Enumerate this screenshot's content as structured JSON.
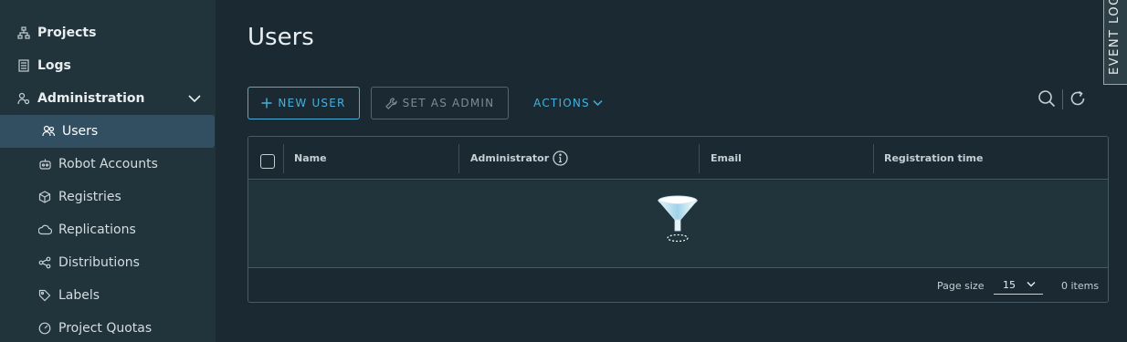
{
  "sidebar": {
    "items": [
      {
        "label": "Projects",
        "icon": "projects-icon"
      },
      {
        "label": "Logs",
        "icon": "logs-icon"
      },
      {
        "label": "Administration",
        "icon": "administration-icon",
        "expanded": true
      },
      {
        "label": "Users",
        "icon": "users-icon",
        "active": true
      },
      {
        "label": "Robot Accounts",
        "icon": "robot-icon"
      },
      {
        "label": "Registries",
        "icon": "registries-icon"
      },
      {
        "label": "Replications",
        "icon": "replications-icon"
      },
      {
        "label": "Distributions",
        "icon": "distributions-icon"
      },
      {
        "label": "Labels",
        "icon": "labels-icon"
      },
      {
        "label": "Project Quotas",
        "icon": "quotas-icon"
      }
    ]
  },
  "main": {
    "title": "Users",
    "toolbar": {
      "new_user_label": "NEW USER",
      "set_admin_label": "SET AS ADMIN",
      "actions_label": "ACTIONS"
    },
    "grid": {
      "columns": [
        "Name",
        "Administrator",
        "Email",
        "Registration time"
      ],
      "rows": [],
      "footer": {
        "page_size_label": "Page size",
        "page_size_value": "15",
        "items_count": "0 items"
      }
    }
  },
  "event_log": {
    "label": "EVENT LOG"
  },
  "colors": {
    "accent": "#49afd9",
    "background": "#1b2a32",
    "sidebar": "#21333b",
    "active_item": "#324f61"
  }
}
